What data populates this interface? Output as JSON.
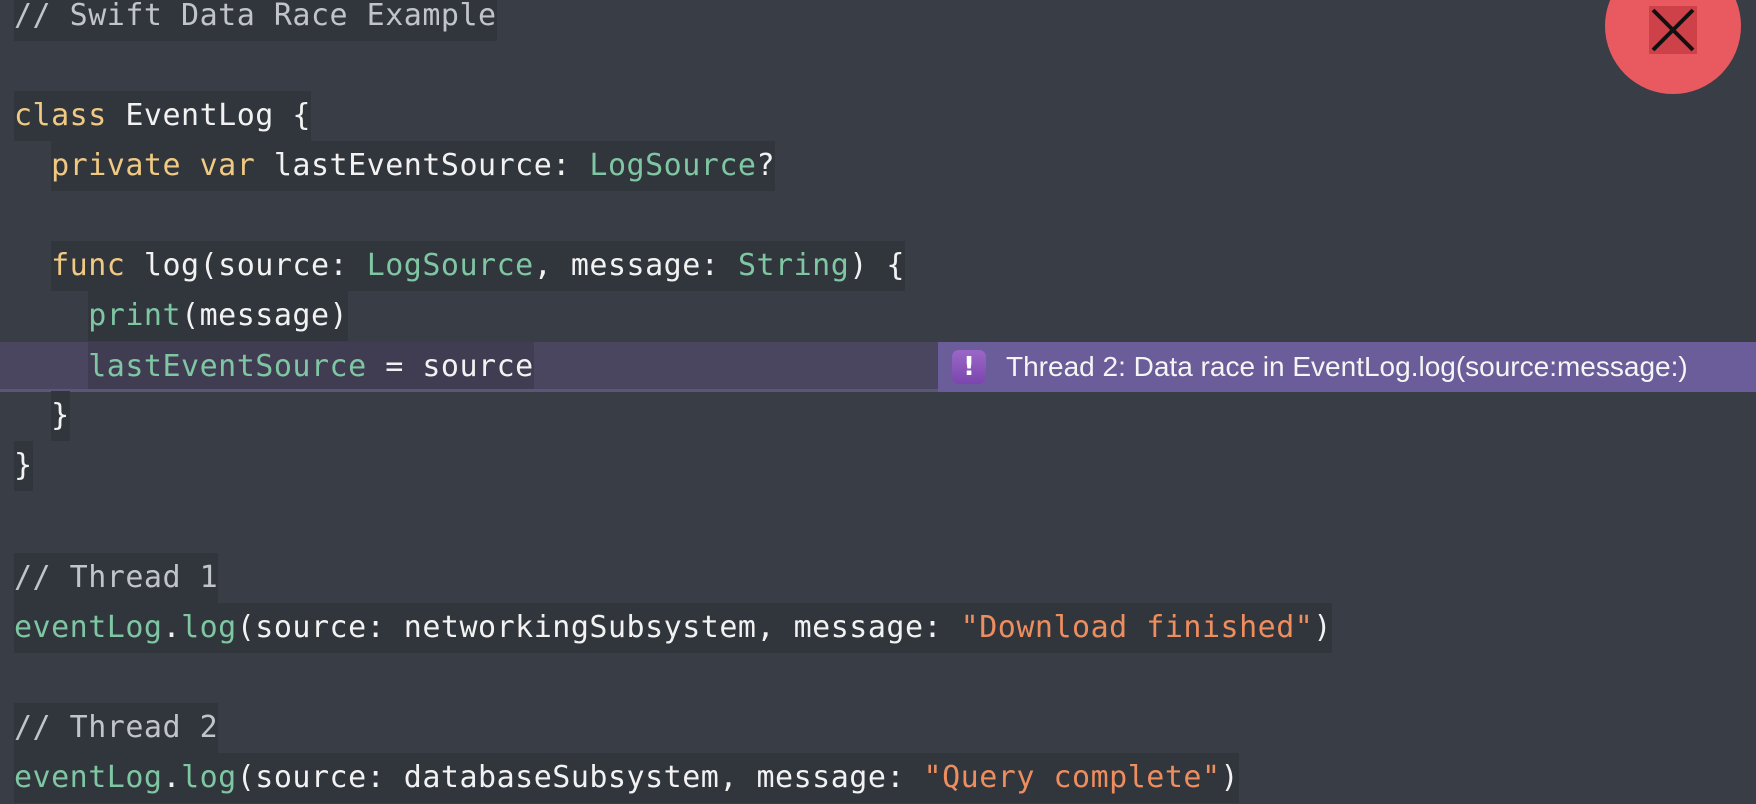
{
  "close_button": {
    "icon": "close-icon",
    "color": "#e95a60"
  },
  "issue": {
    "icon": "exclamation-icon",
    "icon_glyph": "!",
    "message": "Thread 2: Data race in EventLog.log(source:message:)",
    "color": "#6b5d99"
  },
  "code": {
    "lines": [
      [
        {
          "t": "// Swift Data Race Example",
          "c": "comment"
        }
      ],
      [],
      [
        {
          "t": "class",
          "c": "keyword"
        },
        {
          "t": " EventLog {",
          "c": "plain"
        }
      ],
      [
        {
          "t": "private",
          "c": "keyword"
        },
        {
          "t": " ",
          "c": "plain"
        },
        {
          "t": "var",
          "c": "keyword"
        },
        {
          "t": " lastEventSource: ",
          "c": "plain"
        },
        {
          "t": "LogSource",
          "c": "type"
        },
        {
          "t": "?",
          "c": "plain"
        }
      ],
      [],
      [
        {
          "t": "func",
          "c": "keyword"
        },
        {
          "t": " log(source: ",
          "c": "plain"
        },
        {
          "t": "LogSource",
          "c": "type"
        },
        {
          "t": ", message: ",
          "c": "plain"
        },
        {
          "t": "String",
          "c": "type"
        },
        {
          "t": ") {",
          "c": "plain"
        }
      ],
      [
        {
          "t": "print",
          "c": "ident"
        },
        {
          "t": "(message)",
          "c": "plain"
        }
      ],
      [
        {
          "t": "lastEventSource",
          "c": "ident"
        },
        {
          "t": " = source",
          "c": "plain"
        }
      ],
      [
        {
          "t": "}",
          "c": "plain"
        }
      ],
      [
        {
          "t": "}",
          "c": "plain"
        }
      ],
      [],
      [
        {
          "t": "// Thread 1",
          "c": "comment"
        }
      ],
      [
        {
          "t": "eventLog",
          "c": "ident"
        },
        {
          "t": ".",
          "c": "plain"
        },
        {
          "t": "log",
          "c": "ident"
        },
        {
          "t": "(source: networkingSubsystem, message: ",
          "c": "plain"
        },
        {
          "t": "\"Download finished\"",
          "c": "string"
        },
        {
          "t": ")",
          "c": "plain"
        }
      ],
      [],
      [
        {
          "t": "// Thread 2",
          "c": "comment"
        }
      ],
      [
        {
          "t": "eventLog",
          "c": "ident"
        },
        {
          "t": ".",
          "c": "plain"
        },
        {
          "t": "log",
          "c": "ident"
        },
        {
          "t": "(source: databaseSubsystem, message: ",
          "c": "plain"
        },
        {
          "t": "\"Query complete\"",
          "c": "string"
        },
        {
          "t": ")",
          "c": "plain"
        }
      ]
    ]
  }
}
